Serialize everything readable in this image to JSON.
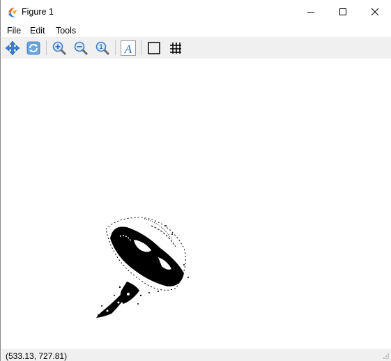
{
  "window": {
    "title": "Figure 1"
  },
  "menu": {
    "items": [
      "File",
      "Edit",
      "Tools"
    ]
  },
  "toolbar": {
    "buttons": [
      "pan-icon",
      "reset-view-icon",
      "zoom-in-icon",
      "zoom-out-icon",
      "zoom-fit-icon",
      "axis-font-icon",
      "box-toggle-icon",
      "grid-toggle-icon"
    ]
  },
  "status": {
    "coords": "(533.13, 727.81)"
  },
  "colors": {
    "toolbar_bg": "#f0f0f0",
    "accent_blue": "#3b7fcc"
  }
}
